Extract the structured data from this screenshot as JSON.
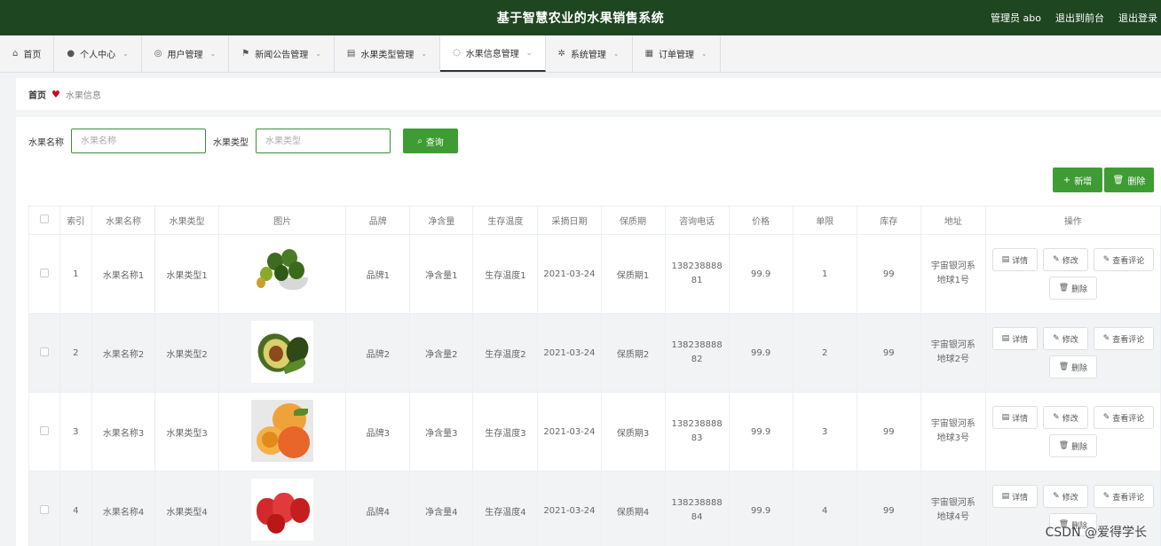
{
  "header": {
    "title": "基于智慧农业的水果销售系统",
    "admin": "管理员 abo",
    "to_front": "退出到前台",
    "logout": "退出登录"
  },
  "nav": [
    {
      "label": "首页",
      "icon": "home-icon",
      "glyph": "⌂",
      "dropdown": false
    },
    {
      "label": "个人中心",
      "icon": "user-icon",
      "glyph": "●",
      "dropdown": true
    },
    {
      "label": "用户管理",
      "icon": "users-icon",
      "glyph": "◎",
      "dropdown": true
    },
    {
      "label": "新闻公告管理",
      "icon": "flag-icon",
      "glyph": "⚑",
      "dropdown": true
    },
    {
      "label": "水果类型管理",
      "icon": "list-icon",
      "glyph": "▤",
      "dropdown": true
    },
    {
      "label": "水果信息管理",
      "icon": "info-icon",
      "glyph": "◌",
      "dropdown": true,
      "active": true
    },
    {
      "label": "系统管理",
      "icon": "gear-icon",
      "glyph": "✲",
      "dropdown": true
    },
    {
      "label": "订单管理",
      "icon": "document-icon",
      "glyph": "▦",
      "dropdown": true
    }
  ],
  "breadcrumb": {
    "home": "首页",
    "current": "水果信息"
  },
  "search": {
    "name_label": "水果名称",
    "name_placeholder": "水果名称",
    "type_label": "水果类型",
    "type_placeholder": "水果类型",
    "query_label": "查询"
  },
  "actions": {
    "add_label": "新增",
    "delete_label": "删除"
  },
  "table": {
    "columns": [
      "索引",
      "水果名称",
      "水果类型",
      "图片",
      "品牌",
      "净含量",
      "生存温度",
      "采摘日期",
      "保质期",
      "咨询电话",
      "价格",
      "单限",
      "库存",
      "地址",
      "操作"
    ],
    "row_ops": {
      "detail": "详情",
      "edit": "修改",
      "review": "查看评论",
      "delete": "删除"
    },
    "rows": [
      {
        "index": "1",
        "name": "水果名称1",
        "type": "水果类型1",
        "brand": "品牌1",
        "net": "净含量1",
        "temp": "生存温度1",
        "date": "2021-03-24",
        "shelf": "保质期1",
        "phone_a": "138238888",
        "phone_b": "81",
        "price": "99.9",
        "limit": "1",
        "stock": "99",
        "addr_a": "宇宙银河系",
        "addr_b": "地球1号",
        "image": "limes"
      },
      {
        "index": "2",
        "name": "水果名称2",
        "type": "水果类型2",
        "brand": "品牌2",
        "net": "净含量2",
        "temp": "生存温度2",
        "date": "2021-03-24",
        "shelf": "保质期2",
        "phone_a": "138238888",
        "phone_b": "82",
        "price": "99.9",
        "limit": "2",
        "stock": "99",
        "addr_a": "宇宙银河系",
        "addr_b": "地球2号",
        "image": "avocado"
      },
      {
        "index": "3",
        "name": "水果名称3",
        "type": "水果类型3",
        "brand": "品牌3",
        "net": "净含量3",
        "temp": "生存温度3",
        "date": "2021-03-24",
        "shelf": "保质期3",
        "phone_a": "138238888",
        "phone_b": "83",
        "price": "99.9",
        "limit": "3",
        "stock": "99",
        "addr_a": "宇宙银河系",
        "addr_b": "地球3号",
        "image": "apricot"
      },
      {
        "index": "4",
        "name": "水果名称4",
        "type": "水果类型4",
        "brand": "品牌4",
        "net": "净含量4",
        "temp": "生存温度4",
        "date": "2021-03-24",
        "shelf": "保质期4",
        "phone_a": "138238888",
        "phone_b": "84",
        "price": "99.9",
        "limit": "4",
        "stock": "99",
        "addr_a": "宇宙银河系",
        "addr_b": "地球4号",
        "image": "wax-apple"
      }
    ]
  },
  "watermark": "CSDN @爱得学长",
  "colors": {
    "header_bg": "#1e4620",
    "accent": "#3f9c35",
    "alt_row": "#f2f3f5"
  }
}
